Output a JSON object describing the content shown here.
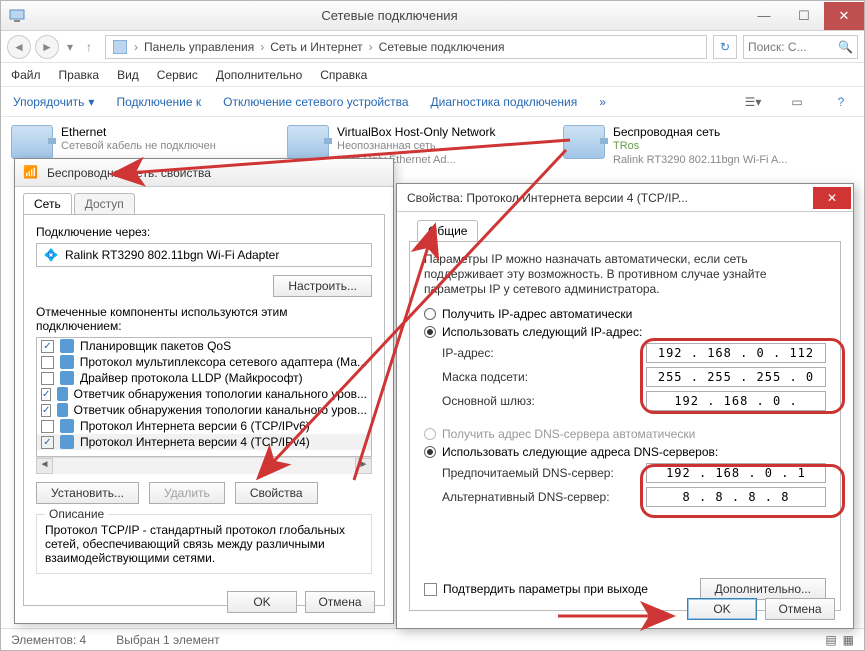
{
  "window": {
    "title": "Сетевые подключения",
    "breadcrumb": {
      "p1": "Панель управления",
      "p2": "Сеть и Интернет",
      "p3": "Сетевые подключения"
    },
    "search_placeholder": "Поиск: С...",
    "menu": {
      "file": "Файл",
      "edit": "Правка",
      "view": "Вид",
      "service": "Сервис",
      "extra": "Дополнительно",
      "help": "Справка"
    },
    "toolbar": {
      "organize": "Упорядочить",
      "connect": "Подключение к",
      "disable": "Отключение сетевого устройства",
      "diagnose": "Диагностика подключения"
    },
    "status": {
      "count": "Элементов: 4",
      "selected": "Выбран 1 элемент"
    }
  },
  "adapters": [
    {
      "name": "Ethernet",
      "l2": "Сетевой кабель не подключен",
      "l3": ""
    },
    {
      "name": "VirtualBox Host-Only Network",
      "l2": "Неопознанная сеть",
      "l3": "Host-Only Ethernet Ad..."
    },
    {
      "name": "Беспроводная сеть",
      "l2": "TRos",
      "l3": "Ralink RT3290 802.11bgn Wi-Fi A..."
    }
  ],
  "props": {
    "title": "Беспроводная сеть: свойства",
    "tab_net": "Сеть",
    "tab_access": "Доступ",
    "connect_via_label": "Подключение через:",
    "adapter": "Ralink RT3290 802.11bgn Wi-Fi Adapter",
    "configure": "Настроить...",
    "components_label": "Отмеченные компоненты используются этим подключением:",
    "components": [
      {
        "checked": true,
        "label": "Планировщик пакетов QoS"
      },
      {
        "checked": false,
        "label": "Протокол мультиплексора сетевого адаптера (Ма..."
      },
      {
        "checked": false,
        "label": "Драйвер протокола LLDP (Майкрософт)"
      },
      {
        "checked": true,
        "label": "Ответчик обнаружения топологии канального уров..."
      },
      {
        "checked": true,
        "label": "Ответчик обнаружения топологии канального уров..."
      },
      {
        "checked": false,
        "label": "Протокол Интернета версии 6 (TCP/IPv6)"
      },
      {
        "checked": true,
        "label": "Протокол Интернета версии 4 (TCP/IPv4)"
      }
    ],
    "install": "Установить...",
    "remove": "Удалить",
    "properties": "Свойства",
    "desc_label": "Описание",
    "desc_text": "Протокол TCP/IP - стандартный протокол глобальных сетей, обеспечивающий связь между различными взаимодействующими сетями.",
    "ok": "OK",
    "cancel": "Отмена"
  },
  "ipv4": {
    "title": "Свойства: Протокол Интернета версии 4 (TCP/IP...",
    "tab_general": "Общие",
    "explain": "Параметры IP можно назначать автоматически, если сеть поддерживает эту возможность. В противном случае узнайте параметры IP у сетевого администратора.",
    "r_auto_ip": "Получить IP-адрес автоматически",
    "r_manual_ip": "Использовать следующий IP-адрес:",
    "ip_label": "IP-адрес:",
    "mask_label": "Маска подсети:",
    "gw_label": "Основной шлюз:",
    "ip": "192 . 168 .  0  . 112",
    "mask": "255 . 255 . 255 .  0",
    "gw": "192 . 168 .  0  .",
    "r_auto_dns": "Получить адрес DNS-сервера автоматически",
    "r_manual_dns": "Использовать следующие адреса DNS-серверов:",
    "dns1_label": "Предпочитаемый DNS-сервер:",
    "dns2_label": "Альтернативный DNS-сервер:",
    "dns1": "192 . 168 .  0  .  1",
    "dns2": " 8  .  8  .  8  .  8",
    "validate": "Подтвердить параметры при выходе",
    "advanced": "Дополнительно...",
    "ok": "OK",
    "cancel": "Отмена"
  }
}
